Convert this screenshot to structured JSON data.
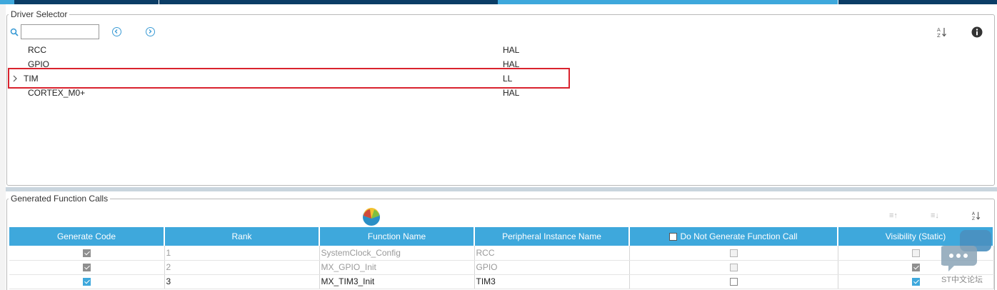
{
  "driver_selector": {
    "legend": "Driver Selector",
    "search": {
      "value": "",
      "placeholder": ""
    },
    "rows": [
      {
        "name": "RCC",
        "library": "HAL",
        "expandable": false
      },
      {
        "name": "GPIO",
        "library": "HAL",
        "expandable": false
      },
      {
        "name": "TIM",
        "library": "LL",
        "expandable": true
      },
      {
        "name": "CORTEX_M0+",
        "library": "HAL",
        "expandable": false
      }
    ],
    "icons": {
      "search": "search-icon",
      "prev": "chevron-left-circle-icon",
      "next": "chevron-right-circle-icon",
      "sort": "sort-az-icon",
      "info": "info-icon"
    }
  },
  "generated_calls": {
    "legend": "Generated Function Calls",
    "columns": {
      "generate_code": "Generate Code",
      "rank": "Rank",
      "function_name": "Function Name",
      "peripheral": "Peripheral Instance Name",
      "do_not_generate": "Do Not Generate Function Call",
      "visibility": "Visibility (Static)"
    },
    "rows": [
      {
        "generate": true,
        "rank": "1",
        "function": "SystemClock_Config",
        "peripheral": "RCC",
        "do_not_generate": false,
        "visibility": false,
        "disabled": true
      },
      {
        "generate": true,
        "rank": "2",
        "function": "MX_GPIO_Init",
        "peripheral": "GPIO",
        "do_not_generate": false,
        "visibility": true,
        "disabled": true
      },
      {
        "generate": true,
        "rank": "3",
        "function": "MX_TIM3_Init",
        "peripheral": "TIM3",
        "do_not_generate": false,
        "visibility": true,
        "disabled": false
      }
    ]
  },
  "watermark": "ST中文论坛",
  "colors": {
    "accent": "#3ea8dc",
    "highlight": "#d9232e",
    "topbar": "#0b3d66"
  }
}
